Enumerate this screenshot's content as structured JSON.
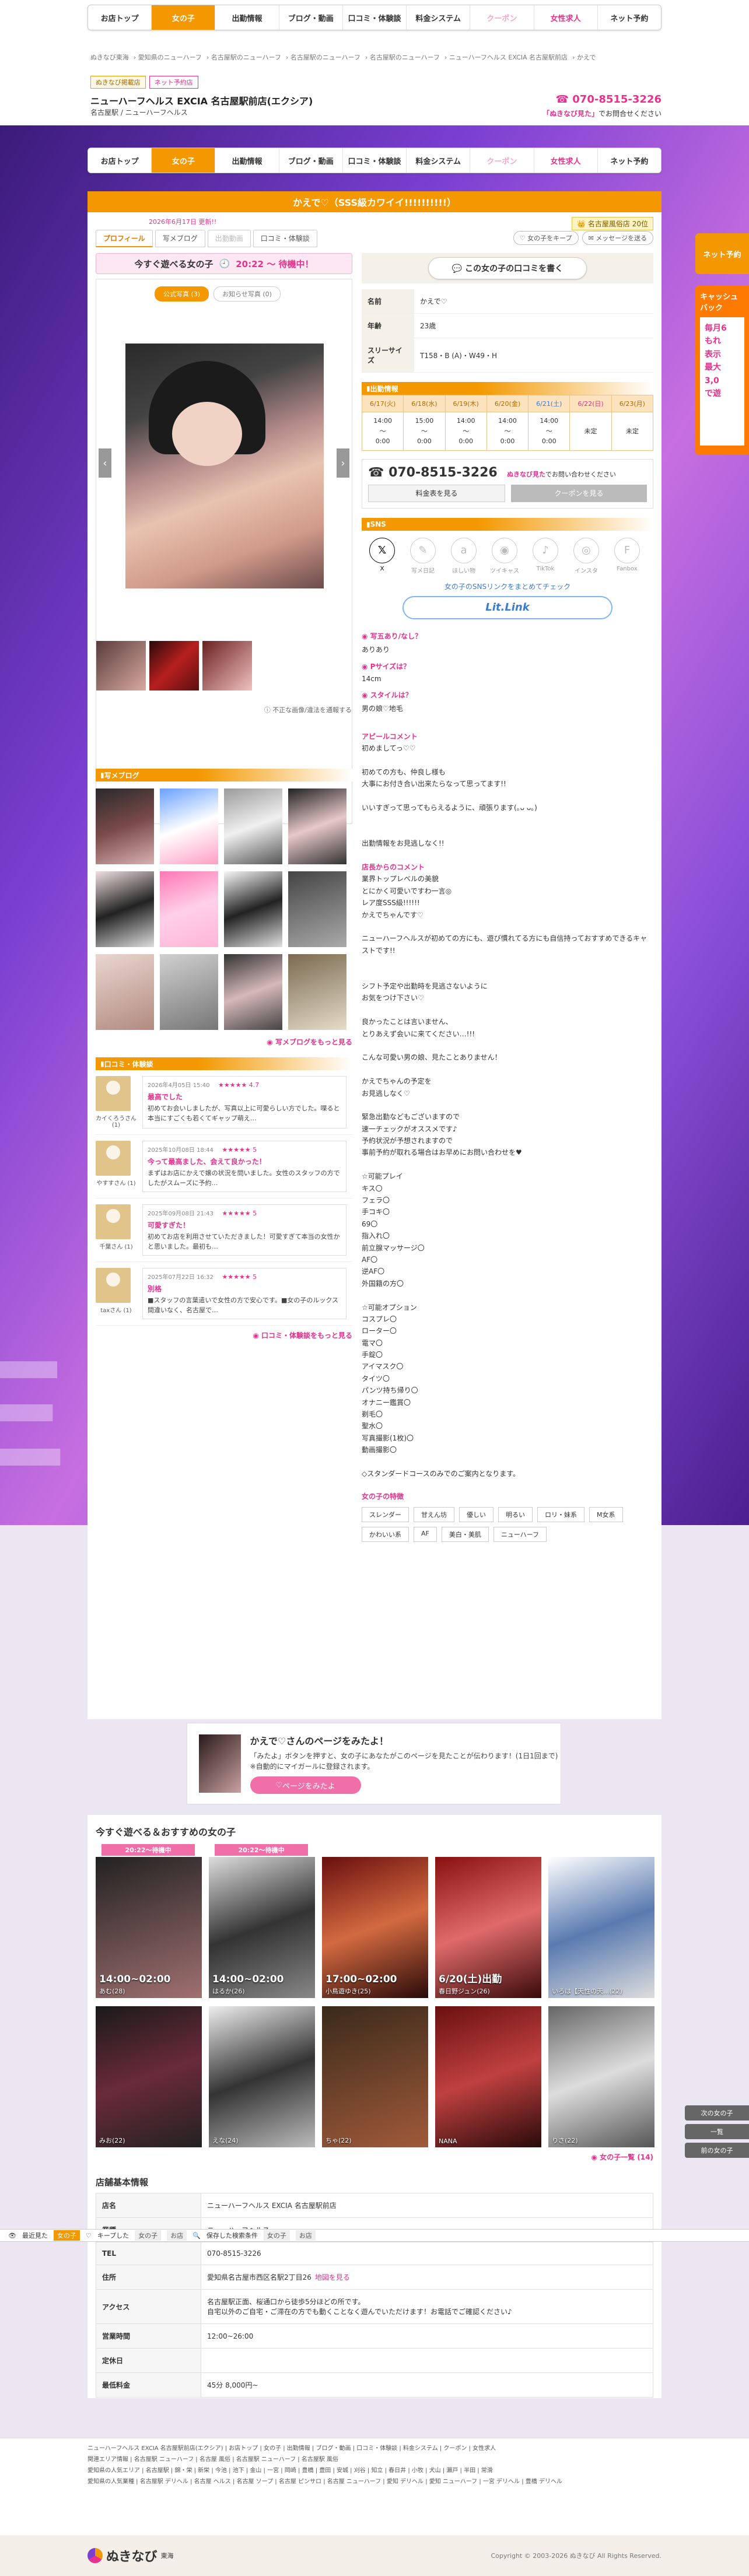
{
  "nav": [
    "お店トップ",
    "女の子",
    "出勤情報",
    "ブログ・動画",
    "口コミ・体験談",
    "料金システム",
    "クーポン",
    "女性求人",
    "ネット予約"
  ],
  "breadcrumbs": [
    "ぬきなび東海",
    "愛知県のニューハーフ",
    "名古屋駅のニューハーフ",
    "名古屋駅のニューハーフ",
    "名古屋駅のニューハーフ",
    "ニューハーフヘルス EXCIA 名古屋駅前店",
    "かえで"
  ],
  "shop": {
    "badge1": "ぬきなび掲載店",
    "badge2": "ネット予約店",
    "name": "ニューハーフヘルス EXCIA 名古屋駅前店(エクシア)",
    "sub": "名古屋駅 / ニューハーフヘルス",
    "tel": "070-8515-3226",
    "note_pre": "「ぬきなび見た」",
    "note_post": "でお問合せください"
  },
  "profile": {
    "title": "かえで♡（SSS級カワイイ!!!!!!!!!!）",
    "date": "2026年6月17日 更新!!",
    "rank": "名古屋風俗店 20位",
    "tabs": [
      "プロフィール",
      "写メブログ",
      "出勤動画",
      "口コミ・体験談"
    ],
    "utils": [
      "女の子をキープ",
      "メッセージを送る"
    ],
    "today_label": "今すぐ遊べる女の子",
    "today_time": "20:22 ～ 待機中！",
    "photo_tabs": [
      "公式写真 (3)",
      "お知らせ写真 (0)"
    ],
    "photo_note": "不正な画像/違法を通報する",
    "review_btn": "この女の子の口コミを書く",
    "rows": [
      {
        "k": "名前",
        "v": "かえで♡"
      },
      {
        "k": "年齢",
        "v": "23歳"
      },
      {
        "k": "スリーサイズ",
        "v": "T158・B (A)・W49・H"
      }
    ]
  },
  "schedule": {
    "title": "出勤情報",
    "days": [
      "6/17(火)",
      "6/18(水)",
      "6/19(木)",
      "6/20(金)",
      "6/21(土)",
      "6/22(日)",
      "6/23(月)"
    ],
    "times": [
      "14:00\n～\n0:00",
      "15:00\n～\n0:00",
      "14:00\n～\n0:00",
      "14:00\n～\n0:00",
      "14:00\n～\n0:00",
      "未定",
      "未定"
    ]
  },
  "tel_box": {
    "tel": "070-8515-3226",
    "note_b": "ぬきなび見た",
    "note": "でお問い合わせください",
    "btn1": "料金表を見る",
    "btn2": "クーポンを見る"
  },
  "sns": {
    "title": "SNS",
    "items": [
      {
        "n": "X",
        "on": true
      },
      {
        "n": "写メ日記",
        "on": false
      },
      {
        "n": "ほしい物",
        "on": false
      },
      {
        "n": "ツイキャス",
        "on": false
      },
      {
        "n": "TikTok",
        "on": false
      },
      {
        "n": "インスタ",
        "on": false
      },
      {
        "n": "Fanbox",
        "on": false
      }
    ],
    "link": "女の子のSNSリンクをまとめてチェック",
    "lit": "Lit.Link"
  },
  "qa": [
    {
      "q": "写五あり/なし？",
      "a": "ありあり"
    },
    {
      "q": "Pサイズは？",
      "a": "14cm"
    },
    {
      "q": "スタイルは？",
      "a": "男の娘♡地毛"
    }
  ],
  "appeal_head": "アピールコメント",
  "appeal": "初めましてっ♡♡\n\n初めての方も、仲良し様も\n大事にお付き合い出来たらなって思ってます!!\n\nいいすぎって思ってもらえるように、頑張ります(｡ᴗ ᴗ｡)\n\n\n出勤情報をお見逃しなく!!",
  "shop_comment_head": "店長からのコメント",
  "shop_comment": "業界トップレベルの美貌\nとにかく可愛いですわ一言◎\nレア度SSS級!!!!!!\nかえでちゃんです♡\n\nニューハーフヘルスが初めての方にも、遊び慣れてる方にも自信持っておすすめできるキャストです!!\n\n\nシフト予定や出勤時を見逃さないように\nお気をつけ下さい♡\n\n良かったことは言いません、\nとりあえず会いに来てください…!!!\n\nこんな可愛い男の娘、見たことありません！\n\nかえでちゃんの予定を\nお見逃しなく♡\n\n緊急出勤などもございますので\n速一チェックがオススメです♪\n予約状況が予想されますので\n事前予約が取れる場合はお早めにお問い合わせを♥",
  "options": "☆可能プレイ\nキス〇\nフェラ〇\n手コキ〇\n69〇\n指入れ〇\n前立腺マッサージ〇\nAF〇\n逆AF〇\n外国籍の方〇\n\n☆可能オプション\nコスプレ〇\nローター〇\n電マ〇\n手錠〇\nアイマスク〇\nタイツ〇\nパンツ持ち帰り〇\nオナニー鑑賞〇\n剃毛〇\n聖水〇\n写真撮影(1枚)〇\n動画撮影〇\n\n◇スタンダードコースのみでのご案内となります。",
  "tags_head": "女の子の特徴",
  "tags": [
    "スレンダー",
    "甘えん坊",
    "優しい",
    "明るい",
    "ロリ・妹系",
    "M女系",
    "かわいい系",
    "AF",
    "美白・美肌",
    "ニューハーフ"
  ],
  "blog": {
    "title": "写メブログ",
    "more": "写メブログをもっと見る"
  },
  "reviews": {
    "title": "口コミ・体験談",
    "items": [
      {
        "name": "カイくろうさん (1)",
        "date": "2026年4月05日 15:40",
        "stars": "★★★★★ 4.7",
        "title": "最高でした",
        "text": "初めてお会いしましたが、写真以上に可愛らしい方でした。喋ると本当にすごくも若くてギャップ萌え…"
      },
      {
        "name": "やすすさん (1)",
        "date": "2025年10月08日 18:44",
        "stars": "★★★★★ 5",
        "title": "今って最高ました、会えて良かった！",
        "text": "まずはお店にかえで嬢の状況を問いました。女性のスタッフの方でしたがスムーズに予約…"
      },
      {
        "name": "千葉さん (1)",
        "date": "2025年09月08日 21:43",
        "stars": "★★★★★ 5",
        "title": "可愛すぎた！",
        "text": "初めてお店を利用させていただきました！可愛すぎて本当の女性かと思いました。最初も…"
      },
      {
        "name": "taxさん (1)",
        "date": "2025年07月22日 16:32",
        "stars": "★★★★★ 5",
        "title": "別格",
        "text": "■スタッフの言葉遣いで女性の方で安心です。■女の子のルックス間違いなく、名古屋で…"
      }
    ],
    "more": "口コミ・体験談をもっと見る"
  },
  "fav": {
    "title": "かえで♡さんのページをみたよ！",
    "text": "「みたよ」ボタンを押すと、女の子にあなたがこのページを見たことが伝わります！(1日1回まで) ※自動的にマイガールに登録されます。",
    "btn": "ページをみたよ"
  },
  "recommend": {
    "title": "今すぐ遊べる＆おすすめの女の子",
    "cards": [
      {
        "badge": "20:22～待機中",
        "time": "14:00~02:00",
        "name": "あむ(28)"
      },
      {
        "badge": "20:22～待機中",
        "time": "14:00~02:00",
        "name": "はるか(26)"
      },
      {
        "badge": "",
        "time": "17:00~02:00",
        "name": "小鳥遊ゆき(25)"
      },
      {
        "badge": "",
        "time": "6/20(土)出勤",
        "name": "春日野ジュン(26)"
      },
      {
        "badge": "",
        "time": "",
        "name": "いろは【天性の天...(22)"
      },
      {
        "badge": "",
        "time": "",
        "name": "みお(22)"
      },
      {
        "badge": "",
        "time": "",
        "name": "えな(24)"
      },
      {
        "badge": "",
        "time": "",
        "name": "ちゃ(22)"
      },
      {
        "badge": "",
        "time": "",
        "name": "NANA"
      },
      {
        "badge": "",
        "time": "",
        "name": "りさ(22)"
      }
    ],
    "more": "女の子一覧 (14)"
  },
  "info": {
    "title": "店舗基本情報",
    "rows": [
      {
        "k": "店名",
        "v": "ニューハーフヘルス EXCIA 名古屋駅前店",
        "map": ""
      },
      {
        "k": "業種",
        "v": "ニューハーフヘルス",
        "map": ""
      },
      {
        "k": "TEL",
        "v": "070-8515-3226",
        "map": ""
      },
      {
        "k": "住所",
        "v": "愛知県名古屋市西区名駅2丁目26",
        "map": "地図を見る"
      },
      {
        "k": "アクセス",
        "v": "名古屋駅正面、桜通口から徒歩5分ほどの所です。\n自宅以外のご自宅・ご滞在の方でも動くことなく遊んでいただけます！お電話でご確認ください♪",
        "map": ""
      },
      {
        "k": "営業時間",
        "v": "12:00~26:00",
        "map": ""
      },
      {
        "k": "定休日",
        "v": "",
        "map": ""
      },
      {
        "k": "最低料金",
        "v": "45分 8,000円~",
        "map": ""
      }
    ]
  },
  "sticky": {
    "recent": "最近見た",
    "girl": "女の子",
    "c1": "キープした",
    "c2": "女の子",
    "c3": "お店",
    "c4": "保存した検索条件",
    "c5": "女の子",
    "c6": "お店"
  },
  "side": {
    "tab": "ネット予約",
    "ad1": "キャッシュバック",
    "ad2": "毎月6\nもれ\n表示\n最大\n3,0\nで遊"
  },
  "floatnav": [
    "次の女の子",
    "一覧",
    "前の女の子"
  ],
  "footer": {
    "l1": "ニューハーフヘルス EXCIA 名古屋駅前店(エクシア) | お店トップ | 女の子 | 出勤情報 | ブログ・動画 | 口コミ・体験談 | 料金システム | クーポン | 女性求人",
    "l2": "関連エリア情報 | 名古屋駅 ニューハーフ | 名古屋 風俗 | 名古屋駅 ニューハーフ | 名古屋駅 風俗",
    "l3": "愛知県の人気エリア | 名古屋駅 | 錦・栄 | 新栄 | 今池 | 池下 | 金山 | 一宮 | 岡崎 | 豊橋 | 豊田 | 安城 | 刈谷 | 知立 | 春日井 | 小牧 | 犬山 | 瀬戸 | 半田 | 常滑",
    "l4": "愛知県の人気業種 | 名古屋駅 デリヘル | 名古屋 ヘルス | 名古屋 ソープ | 名古屋 ピンサロ | 名古屋 ニューハーフ | 愛知 デリヘル | 愛知 ニューハーフ | 一宮 デリヘル | 豊橋 デリヘル",
    "logo": "ぬきなび",
    "logo_sub": "東海",
    "copy": "Copyright © 2003-2026 ぬきなび All Rights Reserved."
  },
  "bgtext": "EW        LT"
}
